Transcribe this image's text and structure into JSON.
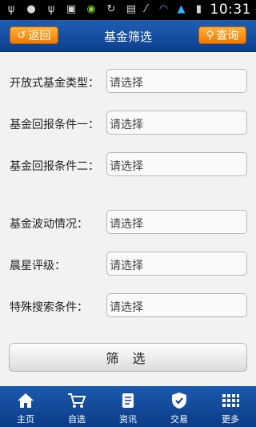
{
  "status_bar": {
    "time": "10:31",
    "icons": [
      "usb-icon",
      "android-icon",
      "usb-icon",
      "image-icon",
      "wechat-icon",
      "sync-icon",
      "message-icon",
      "signal-muted-icon",
      "wifi-icon",
      "signal-icon",
      "battery-icon"
    ]
  },
  "header": {
    "title": "基金筛选",
    "back_label": "返回",
    "search_label": "查询"
  },
  "form": {
    "rows": [
      {
        "label": "开放式基金类型：",
        "value": "请选择"
      },
      {
        "label": "基金回报条件一：",
        "value": "请选择"
      },
      {
        "label": "基金回报条件二：",
        "value": "请选择"
      },
      {
        "label": "基金波动情况：",
        "value": "请选择"
      },
      {
        "label": "晨星评级：",
        "value": "请选择"
      },
      {
        "label": "特殊搜索条件：",
        "value": "请选择"
      }
    ],
    "submit_label": "筛 选"
  },
  "tabbar": {
    "items": [
      {
        "label": "主页",
        "icon": "home-icon"
      },
      {
        "label": "自选",
        "icon": "cart-icon"
      },
      {
        "label": "资讯",
        "icon": "scroll-icon"
      },
      {
        "label": "交易",
        "icon": "shield-icon"
      },
      {
        "label": "更多",
        "icon": "grid-icon"
      }
    ]
  }
}
